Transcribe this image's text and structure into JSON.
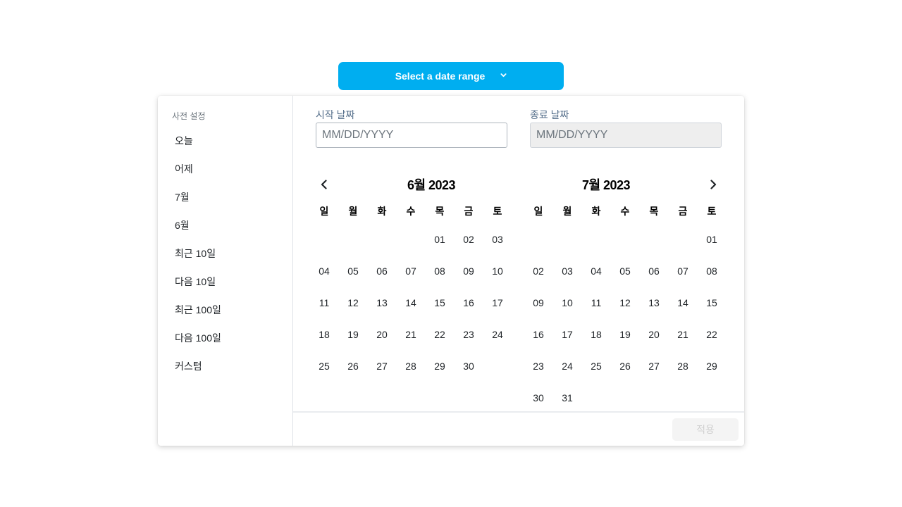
{
  "trigger": {
    "label": "Select a date range",
    "color": "#00aef0"
  },
  "sidebar": {
    "title": "사전 설정",
    "presets": [
      "오늘",
      "어제",
      "7월",
      "6월",
      "최근 10일",
      "다음 10일",
      "최근 100일",
      "다음 100일",
      "커스텀"
    ]
  },
  "start": {
    "label": "시작 날짜",
    "placeholder": "MM/DD/YYYY"
  },
  "end": {
    "label": "종료 날짜",
    "placeholder": "MM/DD/YYYY"
  },
  "weekdays": [
    "일",
    "월",
    "화",
    "수",
    "목",
    "금",
    "토"
  ],
  "months": [
    {
      "title": "6월 2023",
      "weeks": [
        [
          "",
          "",
          "",
          "",
          "01",
          "02",
          "03"
        ],
        [
          "04",
          "05",
          "06",
          "07",
          "08",
          "09",
          "10"
        ],
        [
          "11",
          "12",
          "13",
          "14",
          "15",
          "16",
          "17"
        ],
        [
          "18",
          "19",
          "20",
          "21",
          "22",
          "23",
          "24"
        ],
        [
          "25",
          "26",
          "27",
          "28",
          "29",
          "30",
          ""
        ]
      ]
    },
    {
      "title": "7월 2023",
      "weeks": [
        [
          "",
          "",
          "",
          "",
          "",
          "",
          "01"
        ],
        [
          "02",
          "03",
          "04",
          "05",
          "06",
          "07",
          "08"
        ],
        [
          "09",
          "10",
          "11",
          "12",
          "13",
          "14",
          "15"
        ],
        [
          "16",
          "17",
          "18",
          "19",
          "20",
          "21",
          "22"
        ],
        [
          "23",
          "24",
          "25",
          "26",
          "27",
          "28",
          "29"
        ],
        [
          "30",
          "31",
          "",
          "",
          "",
          "",
          ""
        ]
      ]
    }
  ],
  "footer": {
    "apply_label": "적용",
    "apply_disabled": true
  },
  "icons": {
    "trigger": "chevron-down-icon",
    "prev": "chevron-left-icon",
    "next": "chevron-right-icon"
  }
}
